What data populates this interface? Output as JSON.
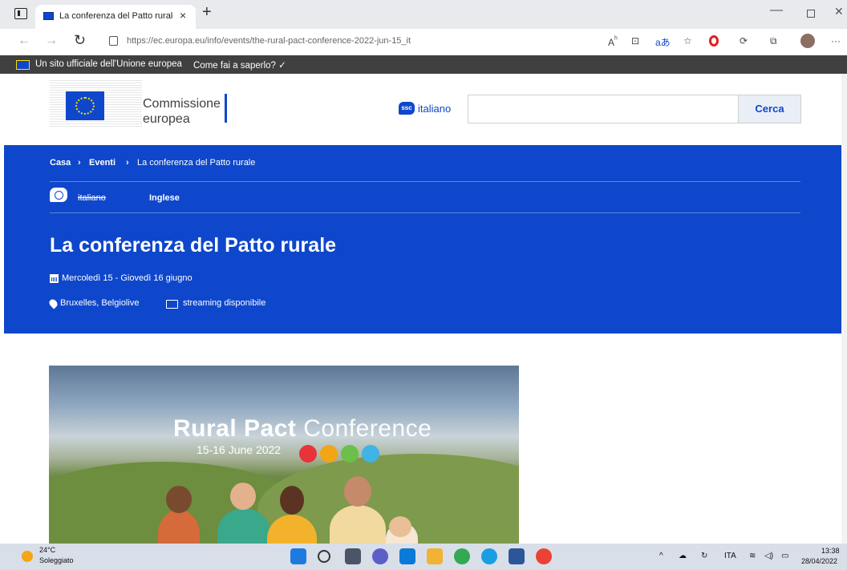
{
  "browser": {
    "tab_title": "La conferenza del Patto rurale | C",
    "tab_close": "×",
    "new_tab": "+",
    "url_host": "https://ec.europa.eu",
    "url_path": "/info/events/the-rural-pact-conference-2022-jun-15_it",
    "window_minimize": "—",
    "window_close": "✕",
    "toolbar_icons": [
      "read-aloud",
      "immersive-reader",
      "translate",
      "favorites",
      "opera",
      "extensions",
      "collections",
      "profile"
    ],
    "more": "···"
  },
  "eu_bar": {
    "text": "Un sito ufficiale dell'Unione europea",
    "link": "Come fai a saperlo? ✓"
  },
  "header": {
    "logo_line1": "Commissione",
    "logo_line2": "europea",
    "language_icon": "ssc",
    "language": "italiano",
    "search_placeholder": "",
    "search_button": "Cerca"
  },
  "breadcrumb": {
    "items": [
      "Casa",
      "Eventi",
      "La conferenza del Patto rurale"
    ],
    "separator": "›"
  },
  "languages": {
    "current_unavailable": "italiano",
    "available": "Inglese"
  },
  "event": {
    "title": "La conferenza del Patto rurale",
    "dates": "Mercoledì 15 - Giovedì 16 giugno",
    "location": "Bruxelles, Belgiolive",
    "streaming": "streaming disponibile"
  },
  "banner": {
    "title_bold": "Rural Pact",
    "title_light": " Conference",
    "date": "15-16 June 2022"
  },
  "taskbar": {
    "temperature": "24°C",
    "weather": "Soleggiato",
    "language": "ITA",
    "time": "13:38",
    "date": "28/04/2022",
    "tray_chevron": "^"
  },
  "colors": {
    "ec_blue": "#0e47cb",
    "eu_bar": "#404040",
    "eu_yellow": "#ffde00"
  }
}
